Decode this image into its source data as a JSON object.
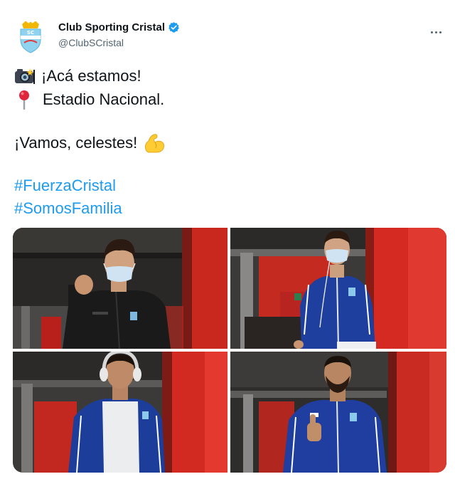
{
  "account": {
    "display_name": "Club Sporting Cristal",
    "handle": "@ClubSCristal",
    "verified_icon": "verified-badge-icon",
    "avatar_icon": "club-crest-logo",
    "more_icon": "more-options-icon"
  },
  "tweet": {
    "line1": "¡Acá estamos!",
    "line1_icon": "camera-flash-emoji",
    "line2": "Estadio Nacional.",
    "line2_icon": "round-pushpin-emoji",
    "line3": "¡Vamos, celestes!",
    "line3_icon": "flexed-biceps-emoji",
    "hashtags": [
      "#FuerzaCristal",
      "#SomosFamilia"
    ]
  },
  "media": {
    "photos": [
      {
        "alt_icon": "player-photo-1"
      },
      {
        "alt_icon": "player-photo-2"
      },
      {
        "alt_icon": "player-photo-3"
      },
      {
        "alt_icon": "player-photo-4"
      }
    ]
  },
  "colors": {
    "link": "#1d9bf0",
    "verified": "#1d9bf0",
    "text": "#0f1419",
    "muted": "#536471",
    "stadium_red": "#d42a22",
    "kit_blue": "#1a3a9c"
  }
}
